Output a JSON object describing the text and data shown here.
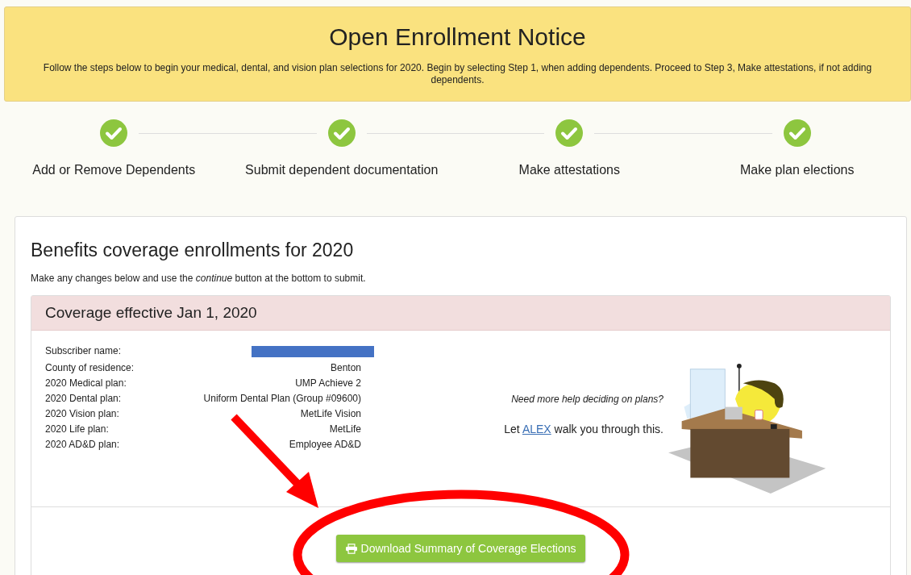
{
  "banner": {
    "title": "Open Enrollment Notice",
    "text": "Follow the steps below to begin your medical, dental, and vision plan selections for 2020. Begin by selecting Step 1, when adding dependents. Proceed to Step 3, Make attestations, if not adding dependents."
  },
  "steps": [
    {
      "label": "Add or Remove Dependents",
      "done": true
    },
    {
      "label": "Submit dependent documentation",
      "done": true
    },
    {
      "label": "Make attestations",
      "done": true
    },
    {
      "label": "Make plan elections",
      "done": true
    }
  ],
  "card": {
    "title": "Benefits coverage enrollments for 2020",
    "subtitle": "Make any changes below and use the *continue* button at the bottom to submit.",
    "panel": {
      "title": "Coverage effective Jan 1, 2020",
      "rows": [
        {
          "label": "Subscriber name:",
          "redacted": true
        },
        {
          "label": "County of residence:",
          "value": "Benton",
          "redacted": false
        },
        {
          "label": "2020 Medical plan:",
          "value": "UMP Achieve 2",
          "redacted": false
        },
        {
          "label": "2020 Dental plan:",
          "value": "Uniform Dental Plan (Group #09600)",
          "redacted": false
        },
        {
          "label": "2020 Vision plan:",
          "value": "MetLife Vision",
          "redacted": false
        },
        {
          "label": "2020 Life plan:",
          "value": "MetLife",
          "redacted": false
        },
        {
          "label": "2020 AD&D plan:",
          "value": "Employee AD&D",
          "redacted": false
        }
      ],
      "help": {
        "question": "Need more help deciding on plans?",
        "prefix": "Let",
        "link": "ALEX",
        "suffix": "walk you through this."
      }
    },
    "download_button": "Download Summary of Coverage Elections"
  }
}
